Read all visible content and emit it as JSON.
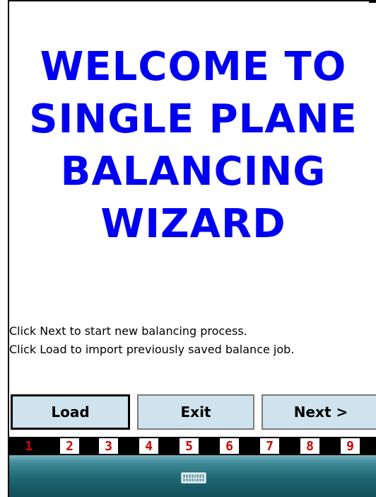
{
  "title_lines": [
    "WELCOME TO",
    "SINGLE PLANE",
    "BALANCING",
    "WIZARD"
  ],
  "instructions": [
    "Click Next to start new balancing process.",
    "Click Load to import previously saved balance job."
  ],
  "buttons": {
    "load": "Load",
    "exit": "Exit",
    "next": "Next >"
  },
  "steps": [
    "1",
    "2",
    "3",
    "4",
    "5",
    "6",
    "7",
    "8",
    "9"
  ],
  "current_step": "1",
  "taskbar": {
    "icon": "keyboard-icon"
  },
  "colors": {
    "title": "#0000f0",
    "button_bg": "#cfe3ee",
    "step_number": "#d40000",
    "taskbar": "#1f6672"
  }
}
